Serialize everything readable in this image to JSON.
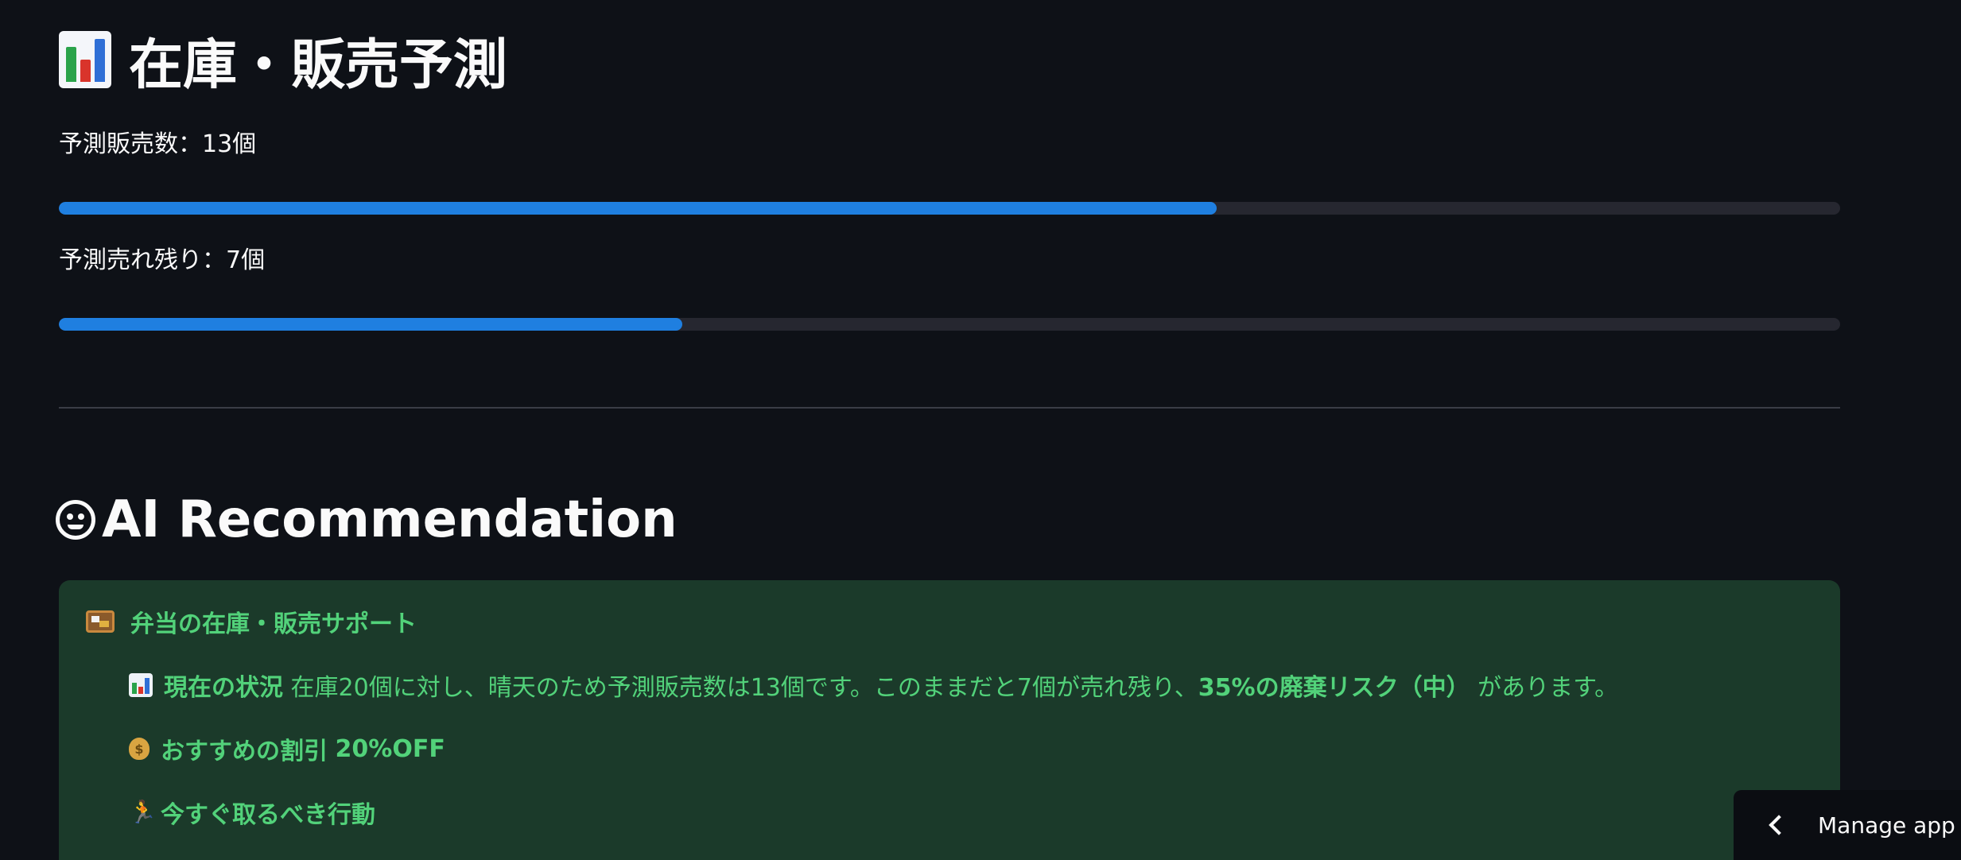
{
  "page": {
    "title": "在庫・販売予測",
    "title_icon": "bar-chart-icon"
  },
  "metrics": [
    {
      "label": "予測販売数：13個",
      "progress": 0.65
    },
    {
      "label": "予測売れ残り：7個",
      "progress": 0.35
    }
  ],
  "recommendation": {
    "section_title": "AI Recommendation",
    "section_icon": "robot-face-icon",
    "heading": "弁当の在庫・販売サポート",
    "heading_icon": "bento-box-icon",
    "status_label": "現在の状況",
    "status_text": "在庫20個に対し、晴天のため予測販売数は13個です。このままだと7個が売れ残り、",
    "status_risk": "35%の廃棄リスク（中）",
    "status_tail": "があります。",
    "status_icon": "bar-chart-icon",
    "discount_label": "おすすめの割引",
    "discount_value": "20%OFF",
    "discount_icon": "money-bag-icon",
    "action_label": "今すぐ取るべき行動",
    "action_icon": "running-person-icon"
  },
  "manage_app": {
    "label": "Manage app",
    "icon": "chevron-left-icon"
  },
  "colors": {
    "background": "#0e1117",
    "progress_fill": "#1f7fe0",
    "progress_track": "#262730",
    "success_bg": "#1b3a2a",
    "success_text": "#52d27a"
  }
}
